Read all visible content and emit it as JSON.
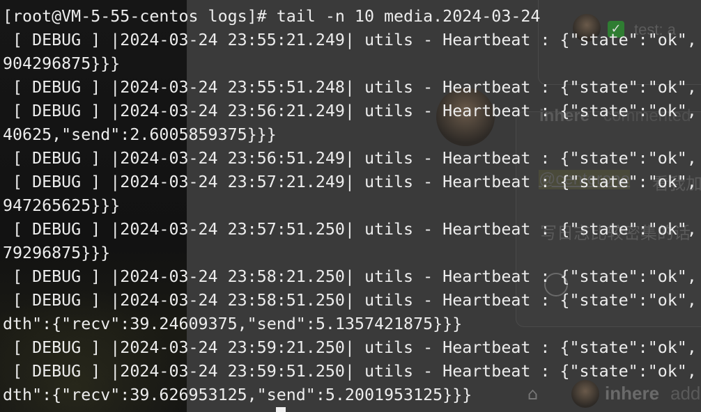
{
  "background_page": {
    "top_text": "test: a",
    "commenter_name": "inhere",
    "commented_text": "commented",
    "mention": "@centerone",
    "mention_suffix": "看我加",
    "chinese_line": "写日志比较密集的话",
    "bottom_name": "inhere",
    "bottom_action": "add",
    "icons": [
      "avatar-icon",
      "check-icon",
      "smile-icon",
      "tag-icon"
    ]
  },
  "terminal": {
    "lines": [
      "[root@VM-5-55-centos logs]# tail -n 10 media.2024-03-24",
      " [ DEBUG ] |2024-03-24 23:55:21.249| utils - Heartbeat : {\"state\":\"ok\",",
      "904296875}}}",
      " [ DEBUG ] |2024-03-24 23:55:51.248| utils - Heartbeat : {\"state\":\"ok\",",
      " [ DEBUG ] |2024-03-24 23:56:21.249| utils - Heartbeat : {\"state\":\"ok\",",
      "40625,\"send\":2.6005859375}}}",
      " [ DEBUG ] |2024-03-24 23:56:51.249| utils - Heartbeat : {\"state\":\"ok\",",
      " [ DEBUG ] |2024-03-24 23:57:21.249| utils - Heartbeat : {\"state\":\"ok\",",
      "947265625}}}",
      " [ DEBUG ] |2024-03-24 23:57:51.250| utils - Heartbeat : {\"state\":\"ok\",",
      "79296875}}}",
      " [ DEBUG ] |2024-03-24 23:58:21.250| utils - Heartbeat : {\"state\":\"ok\",",
      " [ DEBUG ] |2024-03-24 23:58:51.250| utils - Heartbeat : {\"state\":\"ok\",",
      "dth\":{\"recv\":39.24609375,\"send\":5.1357421875}}}",
      " [ DEBUG ] |2024-03-24 23:59:21.250| utils - Heartbeat : {\"state\":\"ok\",",
      " [ DEBUG ] |2024-03-24 23:59:51.250| utils - Heartbeat : {\"state\":\"ok\",",
      "dth\":{\"recv\":39.626953125,\"send\":5.2001953125}}}"
    ]
  }
}
